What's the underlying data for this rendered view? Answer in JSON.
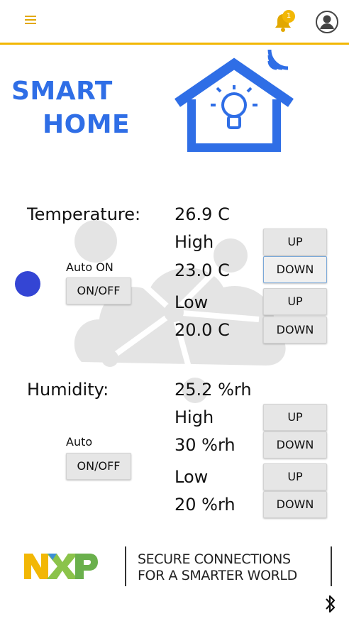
{
  "header": {
    "notification_count": "1",
    "accent_color": "#f2b705"
  },
  "brand": {
    "line1": "SMART",
    "line2": "HOME",
    "color": "#2f6ee6"
  },
  "temperature": {
    "label": "Temperature:",
    "value": "26.9 C",
    "high_label": "High",
    "high_value": "23.0 C",
    "low_label": "Low",
    "low_value": "20.0 C",
    "auto_label": "Auto ON",
    "toggle_label": "ON/OFF",
    "status_color": "#3445d4"
  },
  "humidity": {
    "label": "Humidity:",
    "value": "25.2 %rh",
    "high_label": "High",
    "high_value": "30 %rh",
    "low_label": "Low",
    "low_value": "20 %rh",
    "auto_label": "Auto",
    "toggle_label": "ON/OFF"
  },
  "buttons": {
    "up": "UP",
    "down": "DOWN"
  },
  "footer": {
    "tagline_line1": "SECURE CONNECTIONS",
    "tagline_line2": "FOR A SMARTER WORLD"
  }
}
